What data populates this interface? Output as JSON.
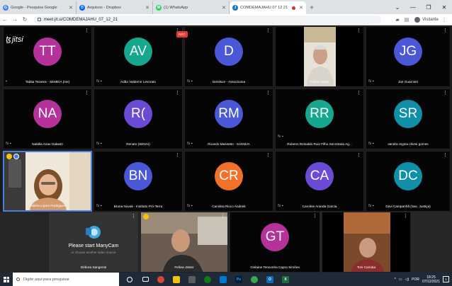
{
  "browser": {
    "tabs": [
      {
        "title": "Google - Pesquisa Google",
        "fav_color": "#4285f4",
        "fav_letter": "G"
      },
      {
        "title": "Arquivos - Dropbox",
        "fav_color": "#0061ff",
        "fav_letter": "D"
      },
      {
        "title": "(1) WhatsApp",
        "fav_color": "#25d366",
        "fav_letter": "W"
      },
      {
        "title": "COMDEMAJAHU 07 12 21",
        "fav_color": "#1d76ba",
        "fav_letter": "J",
        "active": true
      }
    ],
    "new_tab": "+",
    "url": "meet.jit.si/COMDEMAJAHU_07_12_21",
    "profile_label": "Visitante"
  },
  "meeting": {
    "logo_text": "jitsi",
    "rec_label": "REC",
    "participants": [
      {
        "id": "tt",
        "initials": "TT",
        "name": "Tabita Teixeira - SEMEIA (me)",
        "color": "#b4329a"
      },
      {
        "id": "av",
        "initials": "AV",
        "name": "Adão Valdemir Levorato",
        "color": "#16a78f"
      },
      {
        "id": "d",
        "initials": "D",
        "name": "Denilson - Associcana",
        "color": "#4a58d8"
      },
      {
        "id": "fj",
        "initials": "",
        "name": "Fellow Jitster",
        "color": "#000000"
      },
      {
        "id": "jg",
        "initials": "JG",
        "name": "Jair Guarnieri",
        "color": "#4a58d8"
      },
      {
        "id": "na",
        "initials": "NA",
        "name": "Natália Arias Galastri",
        "color": "#b4329a"
      },
      {
        "id": "r",
        "initials": "R(",
        "name": "Renato (SENAI)",
        "color": "#6b4ad6"
      },
      {
        "id": "rm",
        "initials": "RM",
        "name": "Ricardo Massetto - SAEMJA",
        "color": "#4a58d8"
      },
      {
        "id": "rr",
        "initials": "RR",
        "name": "Rubens Reinaldo Ruiz Filho Secretaria Ag...",
        "color": "#16a78f"
      },
      {
        "id": "sr",
        "initials": "SR",
        "name": "sandra regina chiesi gomes",
        "color": "#0f8fa8"
      },
      {
        "id": "vl",
        "initials": "",
        "name": "Valéria Lopes Rodrigues",
        "color": "#000000"
      },
      {
        "id": "bn",
        "initials": "BN",
        "name": "Bruna Novak - Instituto Pró-Terra",
        "color": "#4a58d8"
      },
      {
        "id": "cr",
        "initials": "CR",
        "name": "Carolina Ricco Andreik",
        "color": "#f07127"
      },
      {
        "id": "ca",
        "initials": "CA",
        "name": "Caroline Aranda Garcia",
        "color": "#6b4ad6"
      },
      {
        "id": "dc",
        "initials": "DC",
        "name": "Davi Campanhã (Sec. Justiça)",
        "color": "#0f8fa8"
      },
      {
        "id": "ds",
        "initials": "",
        "name": "Débora Sangersti",
        "color": "#000000"
      },
      {
        "id": "fj2",
        "initials": "",
        "name": "Fellow Jitster",
        "color": "#000000"
      },
      {
        "id": "gt",
        "initials": "GT",
        "name": "Gislaine Tenconha Capra Simões",
        "color": "#b4329a"
      },
      {
        "id": "tc",
        "initials": "",
        "name": "Toni Cariuba",
        "color": "#000000"
      }
    ],
    "manycam_message": "Please start ManyCam",
    "manycam_sub": "or choose another video source"
  },
  "taskbar": {
    "search_placeholder": "Digite aqui para pesquisar",
    "lang": "POR",
    "time": "18:25",
    "date": "07/12/2021",
    "notif_count": "5"
  }
}
